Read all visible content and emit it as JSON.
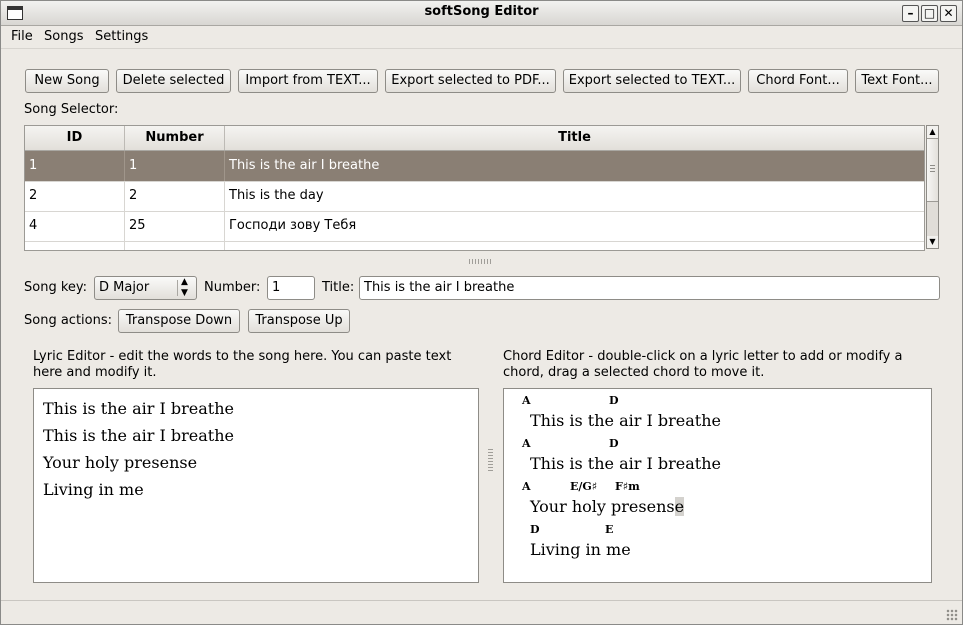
{
  "window": {
    "title": "softSong Editor"
  },
  "menu": {
    "file": "File",
    "songs": "Songs",
    "settings": "Settings"
  },
  "toolbar": {
    "new_song": "New Song",
    "delete_selected": "Delete selected",
    "import_text": "Import from TEXT...",
    "export_pdf": "Export selected to PDF...",
    "export_text": "Export selected to TEXT...",
    "chord_font": "Chord Font...",
    "text_font": "Text Font..."
  },
  "selector": {
    "label": "Song Selector:",
    "columns": [
      "ID",
      "Number",
      "Title"
    ],
    "rows": [
      {
        "id": "1",
        "number": "1",
        "title": "This is the air I breathe",
        "selected": true
      },
      {
        "id": "2",
        "number": "2",
        "title": "This is the day",
        "selected": false
      },
      {
        "id": "4",
        "number": "25",
        "title": "Господи зову Тебя",
        "selected": false
      }
    ]
  },
  "song": {
    "key_label": "Song key:",
    "key_value": "D Major",
    "number_label": "Number:",
    "number_value": "1",
    "title_label": "Title:",
    "title_value": "This is the air I breathe"
  },
  "actions": {
    "label": "Song actions:",
    "transpose_down": "Transpose Down",
    "transpose_up": "Transpose Up"
  },
  "lyric_editor": {
    "caption": "Lyric Editor - edit the words to the song here. You can paste text here and modify it.",
    "lines": [
      "This is the air I breathe",
      "This is the air I breathe",
      "Your holy presense",
      "Living in me"
    ]
  },
  "chord_editor": {
    "caption": "Chord Editor - double-click on a lyric letter to add or modify a chord, drag a selected chord to move it.",
    "chords": [
      "A",
      "D",
      "A",
      "D",
      "A",
      "E/G♯",
      "F♯m",
      "D",
      "E"
    ],
    "lines": [
      "This is the air I breathe",
      "This is the air I breathe",
      "Your holy presens",
      "e",
      "Living in me"
    ]
  }
}
